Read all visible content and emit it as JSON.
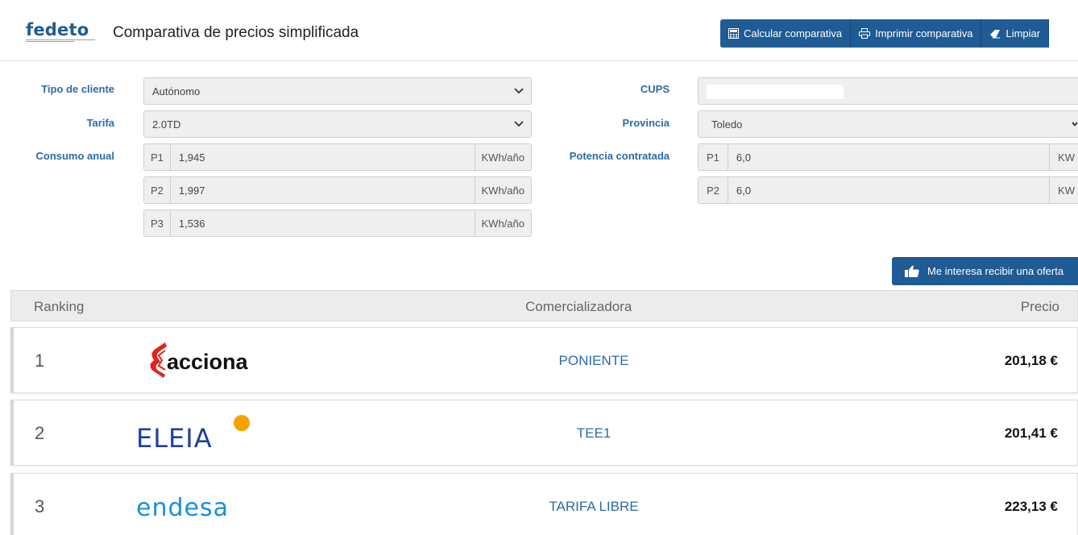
{
  "header": {
    "logo_text": "fedeto",
    "title": "Comparativa de precios simplificada",
    "buttons": {
      "calcular": "Calcular comparativa",
      "imprimir": "Imprimir comparativa",
      "limpiar": "Limpiar"
    }
  },
  "form": {
    "tipo_cliente": {
      "label": "Tipo de cliente",
      "value": "Autónomo"
    },
    "tarifa": {
      "label": "Tarifa",
      "value": "2.0TD"
    },
    "consumo": {
      "label": "Consumo anual",
      "unit": "KWh/año",
      "rows": [
        {
          "period": "P1",
          "value": "1,945"
        },
        {
          "period": "P2",
          "value": "1,997"
        },
        {
          "period": "P3",
          "value": "1,536"
        }
      ]
    },
    "cups": {
      "label": "CUPS",
      "value": ""
    },
    "provincia": {
      "label": "Provincia",
      "value": "Toledo"
    },
    "potencia": {
      "label": "Potencia contratada",
      "unit": "KW",
      "rows": [
        {
          "period": "P1",
          "value": "6,0"
        },
        {
          "period": "P2",
          "value": "6,0"
        }
      ]
    }
  },
  "offer_button": "Me interesa recibir una oferta",
  "table": {
    "headers": {
      "ranking": "Ranking",
      "comercializadora": "Comercializadora",
      "precio": "Precio"
    },
    "rows": [
      {
        "rank": "1",
        "brand": "acciona",
        "product": "PONIENTE",
        "price": "201,18 €"
      },
      {
        "rank": "2",
        "brand": "ELEIA",
        "product": "TEE1",
        "price": "201,41 €"
      },
      {
        "rank": "3",
        "brand": "endesa",
        "product": "TARIFA LIBRE",
        "price": "223,13 €"
      }
    ]
  },
  "colors": {
    "primary": "#1f5b94",
    "label_blue": "#2c6ba8",
    "acciona_red": "#e2231a",
    "eleia_blue": "#1d3f9e",
    "eleia_orange": "#f5a100",
    "endesa_blue": "#1c8ed8"
  }
}
